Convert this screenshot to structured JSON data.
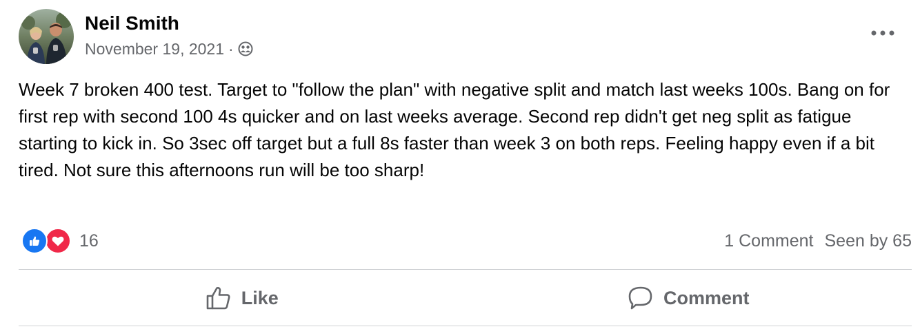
{
  "post": {
    "author": "Neil Smith",
    "date": "November 19, 2021",
    "separator": "·",
    "audience_icon": "friends-icon",
    "more_icon": "more-options-icon",
    "text": "Week 7 broken 400 test. Target to \"follow the plan\" with negative split and match last weeks 100s. Bang on for first rep with second 100 4s quicker and on last weeks average. Second rep didn't get neg split as fatigue starting to kick in. So 3sec off target but a full 8s faster than week 3 on both reps. Feeling happy even if a bit tired. Not sure this afternoons run will be too sharp!"
  },
  "reactions": {
    "icons": [
      "like-reaction-icon",
      "love-reaction-icon"
    ],
    "count": "16",
    "comments": "1 Comment",
    "seen_by": "Seen by 65"
  },
  "actions": {
    "like_label": "Like",
    "comment_label": "Comment"
  },
  "colors": {
    "like_blue": "#1877f2",
    "love_red": "#f02849",
    "secondary_text": "#65676b",
    "primary_text": "#050505",
    "divider": "#ced0d4"
  }
}
